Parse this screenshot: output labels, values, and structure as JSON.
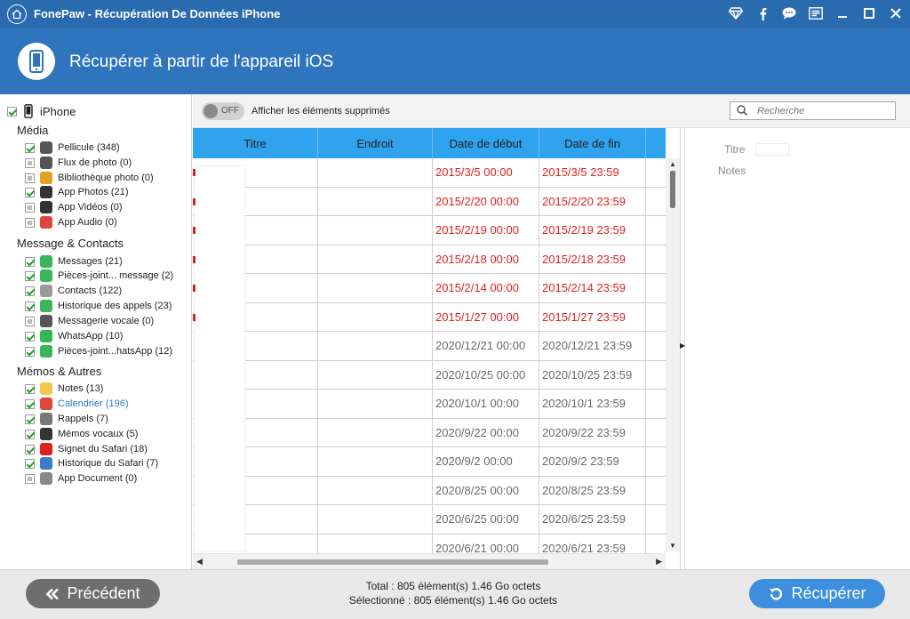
{
  "window": {
    "title": "FonePaw - Récupération De Données iPhone"
  },
  "header": {
    "title": "Récupérer à partir de l'appareil iOS"
  },
  "sidebar": {
    "device": "iPhone",
    "sections": [
      {
        "label": "Média",
        "items": [
          {
            "label": "Pellicule (348)",
            "icon": "camera-icon",
            "state": "checked",
            "color": "#555555"
          },
          {
            "label": "Flux de photo (0)",
            "icon": "photo-stream-icon",
            "state": "partial",
            "color": "#555555"
          },
          {
            "label": "Bibliothèque photo (0)",
            "icon": "photos-icon",
            "state": "partial",
            "color": "#e5a020"
          },
          {
            "label": "App Photos (21)",
            "icon": "app-photos-icon",
            "state": "checked",
            "color": "#333333"
          },
          {
            "label": "App Vidéos (0)",
            "icon": "clapper-icon",
            "state": "partial",
            "color": "#333333"
          },
          {
            "label": "App Audio (0)",
            "icon": "music-icon",
            "state": "partial",
            "color": "#e0453a"
          }
        ]
      },
      {
        "label": "Message & Contacts",
        "items": [
          {
            "label": "Messages (21)",
            "icon": "message-icon",
            "state": "checked",
            "color": "#3cb55a"
          },
          {
            "label": "Pièces-joint... message (2)",
            "icon": "attachment-icon",
            "state": "checked",
            "color": "#3cb55a"
          },
          {
            "label": "Contacts (122)",
            "icon": "contacts-icon",
            "state": "checked",
            "color": "#9a9a9a"
          },
          {
            "label": "Historique des appels (23)",
            "icon": "phone-icon",
            "state": "checked",
            "color": "#3cb55a"
          },
          {
            "label": "Messagerie vocale (0)",
            "icon": "voicemail-icon",
            "state": "partial",
            "color": "#555555"
          },
          {
            "label": "WhatsApp (10)",
            "icon": "whatsapp-icon",
            "state": "checked",
            "color": "#2fb84f"
          },
          {
            "label": "Pièces-joint...hatsApp (12)",
            "icon": "whatsapp-attachment-icon",
            "state": "checked",
            "color": "#3cb55a"
          }
        ]
      },
      {
        "label": "Mémos & Autres",
        "items": [
          {
            "label": "Notes (13)",
            "icon": "notes-icon",
            "state": "checked",
            "color": "#f2c94c"
          },
          {
            "label": "Calendrier (196)",
            "icon": "calendar-icon",
            "state": "checked",
            "color": "#e0453a",
            "active": true
          },
          {
            "label": "Rappels (7)",
            "icon": "reminders-icon",
            "state": "checked",
            "color": "#777777"
          },
          {
            "label": "Mémos vocaux (5)",
            "icon": "voice-memo-icon",
            "state": "checked",
            "color": "#333333"
          },
          {
            "label": "Signet du Safari (18)",
            "icon": "bookmark-icon",
            "state": "checked",
            "color": "#e02020"
          },
          {
            "label": "Historique du Safari (7)",
            "icon": "safari-icon",
            "state": "checked",
            "color": "#3a7cc8"
          },
          {
            "label": "App Document (0)",
            "icon": "document-icon",
            "state": "partial",
            "color": "#888888"
          }
        ]
      }
    ]
  },
  "toolbar": {
    "toggle_state": "OFF",
    "toggle_label": "Afficher les éléments supprimés",
    "search_placeholder": "Recherche"
  },
  "table": {
    "columns": [
      "Titre",
      "Endroit",
      "Date de début",
      "Date de fin"
    ],
    "rows": [
      {
        "start": "2015/3/5 00:00",
        "end": "2015/3/5 23:59",
        "deleted": true
      },
      {
        "start": "2015/2/20 00:00",
        "end": "2015/2/20 23:59",
        "deleted": true
      },
      {
        "start": "2015/2/19 00:00",
        "end": "2015/2/19 23:59",
        "deleted": true
      },
      {
        "start": "2015/2/18 00:00",
        "end": "2015/2/18 23:59",
        "deleted": true
      },
      {
        "start": "2015/2/14 00:00",
        "end": "2015/2/14 23:59",
        "deleted": true
      },
      {
        "start": "2015/1/27 00:00",
        "end": "2015/1/27 23:59",
        "deleted": true
      },
      {
        "start": "2020/12/21 00:00",
        "end": "2020/12/21 23:59",
        "deleted": false
      },
      {
        "start": "2020/10/25 00:00",
        "end": "2020/10/25 23:59",
        "deleted": false
      },
      {
        "start": "2020/10/1 00:00",
        "end": "2020/10/1 23:59",
        "deleted": false
      },
      {
        "start": "2020/9/22 00:00",
        "end": "2020/9/22 23:59",
        "deleted": false
      },
      {
        "start": "2020/9/2 00:00",
        "end": "2020/9/2 23:59",
        "deleted": false
      },
      {
        "start": "2020/8/25 00:00",
        "end": "2020/8/25 23:59",
        "deleted": false
      },
      {
        "start": "2020/6/25 00:00",
        "end": "2020/6/25 23:59",
        "deleted": false
      },
      {
        "start": "2020/6/21 00:00",
        "end": "2020/6/21 23:59",
        "deleted": false
      }
    ]
  },
  "details": {
    "titre_label": "Titre",
    "notes_label": "Notes"
  },
  "footer": {
    "back_label": "Précédent",
    "recover_label": "Récupérer",
    "total": "Total : 805 élément(s) 1.46 Go octets",
    "selected": "Sélectionné : 805 élément(s) 1.46 Go octets"
  },
  "colors": {
    "titlebar": "#2a6bb0",
    "header": "#2f75bd",
    "table_header": "#2fa3ee",
    "deleted_text": "#e02020",
    "recover_button": "#3b8fdc",
    "back_button": "#6e6e6e"
  }
}
